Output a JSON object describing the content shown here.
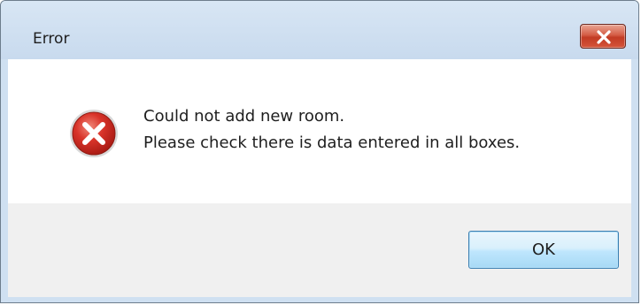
{
  "window": {
    "title": "Error"
  },
  "titlebar": {
    "close_icon": "close-icon"
  },
  "message": {
    "icon": "error-icon",
    "line1": "Could not add new room.",
    "line2": "Please check there is data entered in all boxes."
  },
  "buttons": {
    "ok_label": "OK"
  },
  "colors": {
    "titlebar": "#cfe0f1",
    "close_button": "#c9432c",
    "error_icon": "#c8261c",
    "footer": "#f0f0f0",
    "ok_button_border": "#3c7fb1"
  }
}
